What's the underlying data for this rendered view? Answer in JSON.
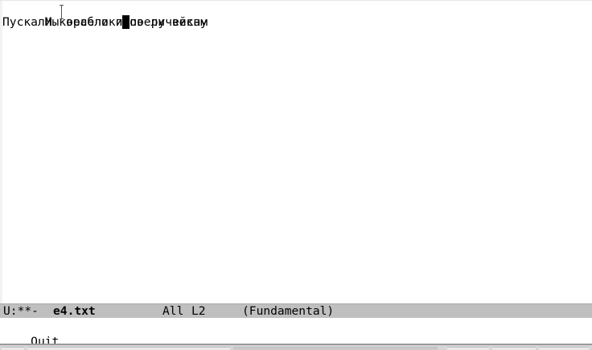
{
  "buffer": {
    "lines": [
      "Мы весело провели весну",
      "Пускали кораблики",
      "по ручейкам"
    ]
  },
  "modeline": {
    "status": "U:**-",
    "filename": "e4.txt",
    "position": "All",
    "line": "L2",
    "mode": "(Fundamental)"
  },
  "minibuffer": {
    "message": "Quit"
  },
  "colors": {
    "modeline_bg": "#bfbfbf",
    "cursor": "#000000",
    "background": "#ffffff"
  },
  "icons": [
    "text-cursor-icon"
  ]
}
